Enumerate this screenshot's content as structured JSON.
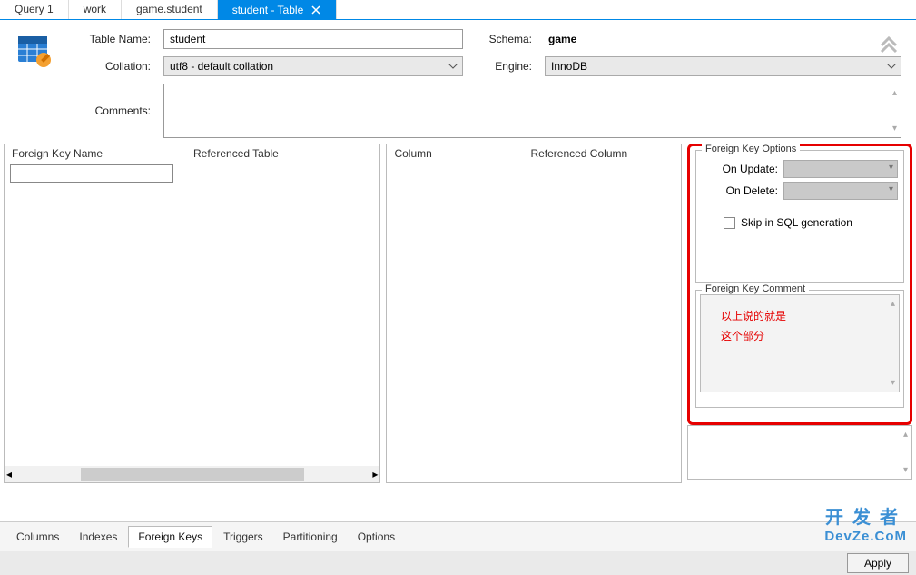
{
  "tabs": [
    {
      "label": "Query 1"
    },
    {
      "label": "work"
    },
    {
      "label": "game.student"
    },
    {
      "label": "student - Table",
      "active": true
    }
  ],
  "form": {
    "table_name_label": "Table Name:",
    "table_name_value": "student",
    "schema_label": "Schema:",
    "schema_value": "game",
    "collation_label": "Collation:",
    "collation_value": "utf8 - default collation",
    "engine_label": "Engine:",
    "engine_value": "InnoDB",
    "comments_label": "Comments:",
    "comments_value": ""
  },
  "fk_grid": {
    "col1": "Foreign Key Name",
    "col2": "Referenced Table",
    "col3": "Column",
    "col4": "Referenced Column"
  },
  "fk_options": {
    "group_title": "Foreign Key Options",
    "on_update_label": "On Update:",
    "on_delete_label": "On Delete:",
    "on_update_value": "",
    "on_delete_value": "",
    "skip_label": "Skip in SQL generation"
  },
  "fk_comment": {
    "group_title": "Foreign Key Comment",
    "annotation_line1": "以上说的就是",
    "annotation_line2": "这个部分"
  },
  "bottom_tabs": [
    "Columns",
    "Indexes",
    "Foreign Keys",
    "Triggers",
    "Partitioning",
    "Options"
  ],
  "bottom_active": "Foreign Keys",
  "footer": {
    "apply": "Apply"
  },
  "watermark": {
    "cn": "开发者",
    "en": "DevZe.CoM"
  }
}
